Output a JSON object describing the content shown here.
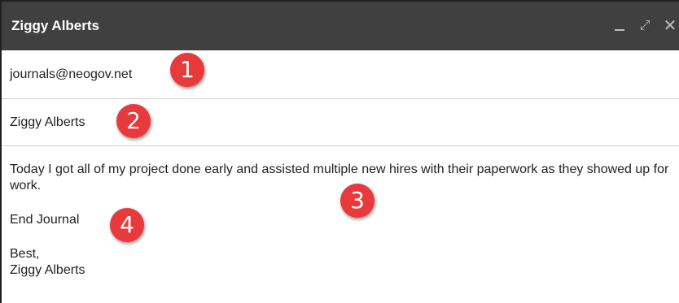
{
  "window": {
    "title": "Ziggy Alberts",
    "minimize_icon": "minimize-icon",
    "expand_icon": "expand-icon",
    "close_label": "✕",
    "expand_label": "⤢"
  },
  "compose": {
    "to": "journals@neogov.net",
    "subject": "Ziggy Alberts",
    "body": {
      "paragraph1": "Today I got all of my project done early and assisted multiple new hires with their paperwork as they showed up for work.",
      "paragraph2": "End Journal",
      "signoff": "Best,",
      "signature": "Ziggy Alberts"
    }
  },
  "annotations": [
    "1",
    "2",
    "3",
    "4"
  ],
  "colors": {
    "titlebar": "#404040",
    "badge": "#e8393c"
  }
}
